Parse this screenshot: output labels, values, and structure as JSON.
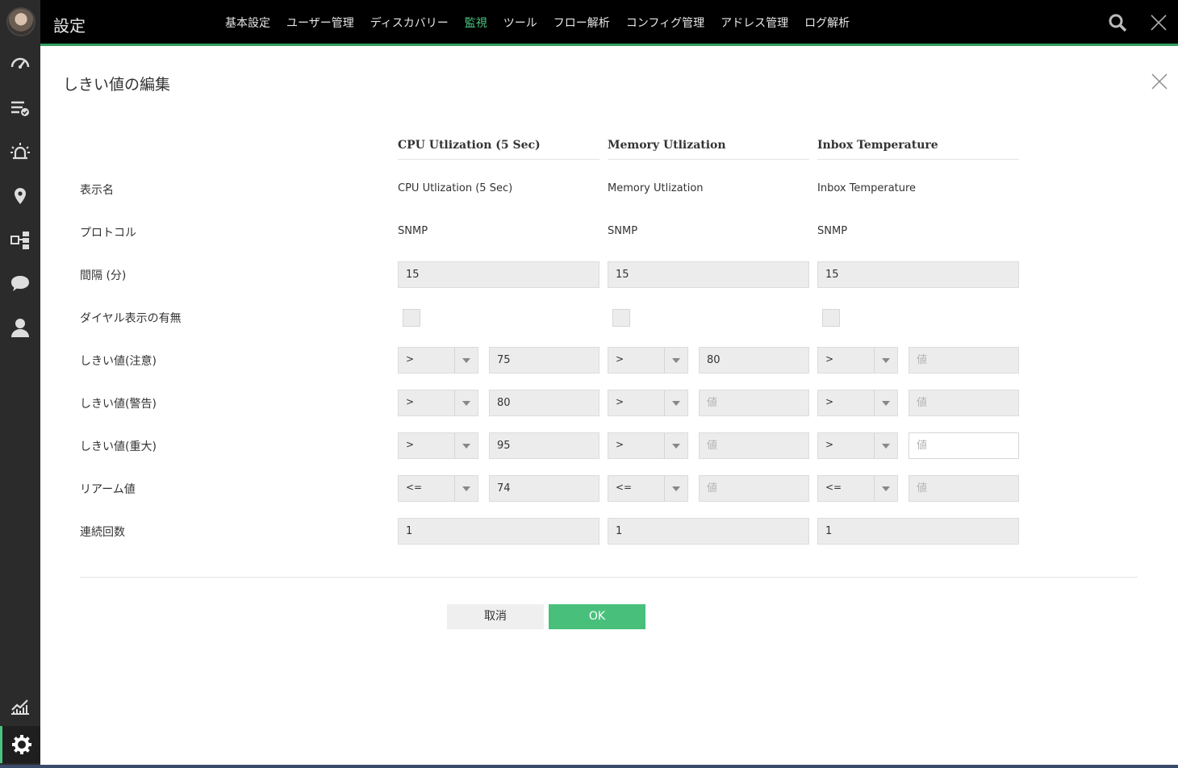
{
  "app": {
    "title": "設定"
  },
  "nav": {
    "items": [
      "基本設定",
      "ユーザー管理",
      "ディスカバリー",
      "監視",
      "ツール",
      "フロー解析",
      "コンフィグ管理",
      "アドレス管理",
      "ログ解析"
    ],
    "active_index": 3
  },
  "sidebar": {
    "icons": [
      "dashboard-icon",
      "inventory-check-icon",
      "alarm-icon",
      "map-pin-icon",
      "network-map-icon",
      "chat-icon",
      "user-icon",
      "reports-icon",
      "settings-icon"
    ],
    "active": "settings-icon"
  },
  "dialog": {
    "title": "しきい値の編集",
    "row_labels": {
      "display_name": "表示名",
      "protocol": "プロトコル",
      "interval": "間隔 (分)",
      "dial": "ダイヤル表示の有無",
      "threshold_attention": "しきい値(注意)",
      "threshold_warning": "しきい値(警告)",
      "threshold_critical": "しきい値(重大)",
      "rearm": "リアーム値",
      "consecutive": "連続回数"
    },
    "placeholder": "値",
    "columns": [
      {
        "header": "CPU Utlization (5 Sec)",
        "display_name": "CPU Utlization (5 Sec)",
        "protocol": "SNMP",
        "interval": "15",
        "attention_op": ">",
        "attention_val": "75",
        "warning_op": ">",
        "warning_val": "80",
        "critical_op": ">",
        "critical_val": "95",
        "rearm_op": "<=",
        "rearm_val": "74",
        "consecutive": "1"
      },
      {
        "header": "Memory Utlization",
        "display_name": "Memory Utlization",
        "protocol": "SNMP",
        "interval": "15",
        "attention_op": ">",
        "attention_val": "80",
        "warning_op": ">",
        "warning_val": "",
        "critical_op": ">",
        "critical_val": "",
        "rearm_op": "<=",
        "rearm_val": "",
        "consecutive": "1"
      },
      {
        "header": "Inbox Temperature",
        "display_name": "Inbox Temperature",
        "protocol": "SNMP",
        "interval": "15",
        "attention_op": ">",
        "attention_val": "",
        "warning_op": ">",
        "warning_val": "",
        "critical_op": ">",
        "critical_val": "",
        "rearm_op": "<=",
        "rearm_val": "",
        "consecutive": "1"
      }
    ],
    "buttons": {
      "cancel": "取消",
      "ok": "OK"
    }
  },
  "colors": {
    "accent": "#4cc37e",
    "ok_button": "#48c07b",
    "topbar": "#000000",
    "rail": "#2b2b2b"
  }
}
